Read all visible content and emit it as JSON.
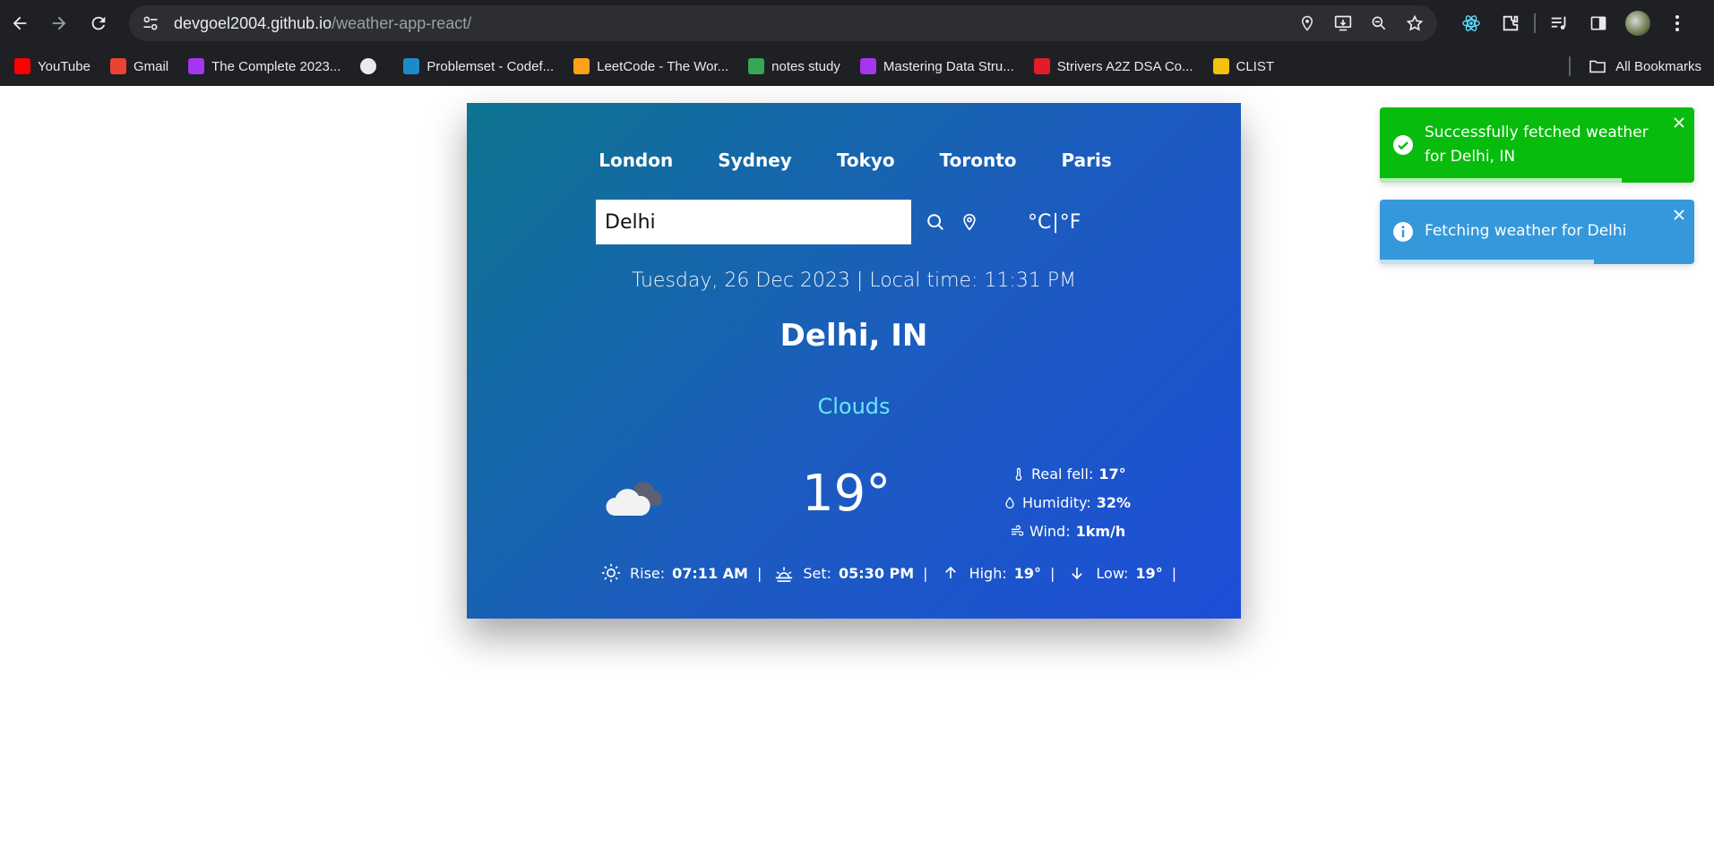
{
  "browser": {
    "url_host": "devgoel2004.github.io",
    "url_path": "/weather-app-react/",
    "bookmarks": [
      {
        "label": "YouTube",
        "color": "#ff0000"
      },
      {
        "label": "Gmail",
        "color": "#ea4335"
      },
      {
        "label": "The Complete 2023...",
        "color": "#a435f0"
      },
      {
        "label": "",
        "color": "#e8eaed"
      },
      {
        "label": "Problemset - Codef...",
        "color": "#1f8acb"
      },
      {
        "label": "LeetCode - The Wor...",
        "color": "#ffa116"
      },
      {
        "label": "notes study",
        "color": "#34a853"
      },
      {
        "label": "Mastering Data Stru...",
        "color": "#a435f0"
      },
      {
        "label": "Strivers A2Z DSA Co...",
        "color": "#e11d2a"
      },
      {
        "label": "CLIST",
        "color": "#f4c20d"
      }
    ],
    "all_bookmarks": "All Bookmarks"
  },
  "weather": {
    "cities": [
      "London",
      "Sydney",
      "Tokyo",
      "Toronto",
      "Paris"
    ],
    "search_value": "Delhi",
    "unit_c": "°C",
    "unit_sep": "|",
    "unit_f": "°F",
    "datetime": "Tuesday, 26 Dec 2023 | Local time: 11:31 PM",
    "location": "Delhi, IN",
    "condition": "Clouds",
    "temp": "19°",
    "details": {
      "real_feel_label": "Real fell:",
      "real_feel_value": "17°",
      "humidity_label": "Humidity:",
      "humidity_value": "32%",
      "wind_label": "Wind:",
      "wind_value": "1km/h"
    },
    "bottom": {
      "rise_label": "Rise:",
      "rise_value": "07:11 AM",
      "set_label": "Set:",
      "set_value": "05:30 PM",
      "high_label": "High:",
      "high_value": "19°",
      "low_label": "Low:",
      "low_value": "19°",
      "pipe": "|"
    }
  },
  "toasts": {
    "success": {
      "text": "Successfully fetched weather for Delhi, IN",
      "color": "#07bc0c",
      "progress": 0.77
    },
    "info": {
      "text": "Fetching weather for Delhi",
      "color": "#3498db",
      "progress": 0.68
    }
  }
}
